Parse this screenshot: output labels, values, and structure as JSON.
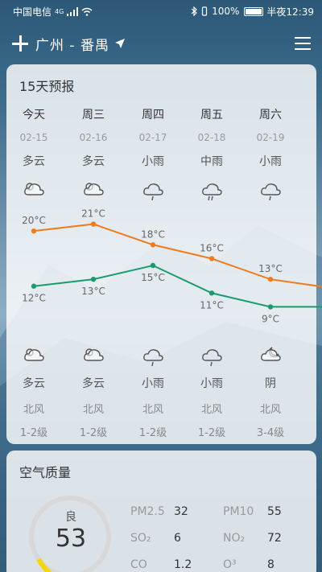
{
  "status": {
    "carrier": "中国电信",
    "network": "4G",
    "battery": "100%",
    "time": "半夜12:39"
  },
  "header": {
    "city": "广州 - 番禺"
  },
  "forecast": {
    "title": "15天预报",
    "days": [
      {
        "name": "今天",
        "date": "02-15",
        "day_cond": "多云",
        "day_icon": "cloudy-icon",
        "high": "20°C",
        "low": "12°C",
        "night_cond": "多云",
        "night_icon": "cloudy-icon",
        "wind": "北风",
        "level": "1-2级"
      },
      {
        "name": "周三",
        "date": "02-16",
        "day_cond": "多云",
        "day_icon": "cloudy-icon",
        "high": "21°C",
        "low": "13°C",
        "night_cond": "多云",
        "night_icon": "cloudy-icon",
        "wind": "北风",
        "level": "1-2级"
      },
      {
        "name": "周四",
        "date": "02-17",
        "day_cond": "小雨",
        "day_icon": "light-rain-icon",
        "high": "18°C",
        "low": "15°C",
        "night_cond": "小雨",
        "night_icon": "light-rain-icon",
        "wind": "北风",
        "level": "1-2级"
      },
      {
        "name": "周五",
        "date": "02-18",
        "day_cond": "中雨",
        "day_icon": "moderate-rain-icon",
        "high": "16°C",
        "low": "11°C",
        "night_cond": "小雨",
        "night_icon": "light-rain-icon",
        "wind": "北风",
        "level": "1-2级"
      },
      {
        "name": "周六",
        "date": "02-19",
        "day_cond": "小雨",
        "day_icon": "light-rain-icon",
        "high": "13°C",
        "low": "9°C",
        "night_cond": "阴",
        "night_icon": "overcast-night-icon",
        "wind": "北风",
        "level": "3-4级"
      }
    ]
  },
  "chart_data": {
    "type": "line",
    "categories": [
      "今天",
      "周三",
      "周四",
      "周五",
      "周六"
    ],
    "series": [
      {
        "values": [
          20,
          21,
          18,
          16,
          13
        ],
        "color": "#f07b1e"
      },
      {
        "values": [
          12,
          13,
          15,
          11,
          9
        ],
        "color": "#1a9b6b"
      }
    ]
  },
  "aqi": {
    "title": "空气质量",
    "level": "良",
    "value": "53",
    "pollutants": [
      {
        "name": "PM2.5",
        "value": "32"
      },
      {
        "name": "PM10",
        "value": "55"
      },
      {
        "name": "SO₂",
        "value": "6"
      },
      {
        "name": "NO₂",
        "value": "72"
      },
      {
        "name": "CO",
        "value": "1.2"
      },
      {
        "name": "O³",
        "value": "8"
      }
    ]
  }
}
